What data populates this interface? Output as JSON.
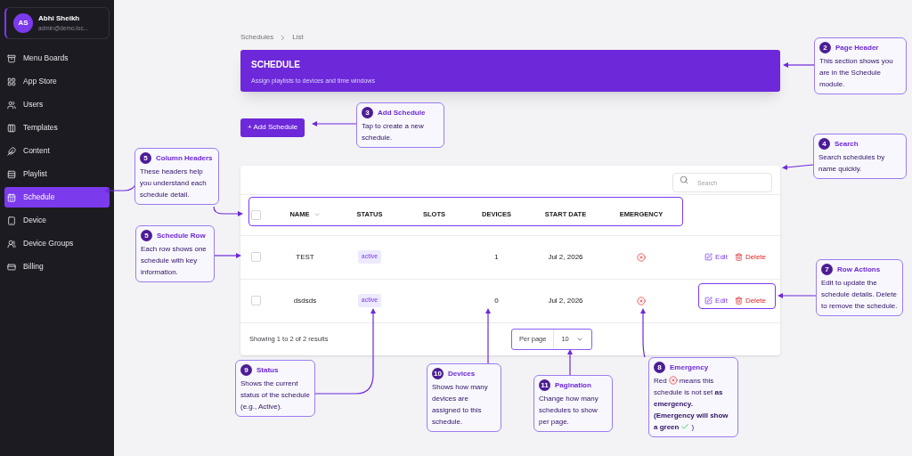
{
  "profile": {
    "initials": "AS",
    "name": "Abhi Sheikh",
    "email": "admin@demo.loc..."
  },
  "sidebar": {
    "items": [
      {
        "label": "Menu Boards",
        "kind": "box",
        "selected": false
      },
      {
        "label": "App Store",
        "kind": "apps",
        "selected": false
      },
      {
        "label": "Users",
        "kind": "users",
        "selected": false
      },
      {
        "label": "Templates",
        "kind": "columns",
        "selected": false
      },
      {
        "label": "Content",
        "kind": "feather",
        "selected": false
      },
      {
        "label": "Playlist",
        "kind": "rows",
        "selected": false
      },
      {
        "label": "Schedule",
        "kind": "calendar",
        "selected": true
      },
      {
        "label": "Device",
        "kind": "tablet",
        "selected": false
      },
      {
        "label": "Device Groups",
        "kind": "group",
        "selected": false
      },
      {
        "label": "Billing",
        "kind": "card",
        "selected": false
      }
    ]
  },
  "breadcrumb": [
    "Schedules",
    "List"
  ],
  "header": {
    "title": "SCHEDULE",
    "subtitle": "Assign playlists to devices and time windows"
  },
  "add_button": "+ Add Schedule",
  "search": {
    "placeholder": "Search"
  },
  "table": {
    "all_checked": false,
    "columns": [
      "NAME",
      "STATUS",
      "SLOTS",
      "DEVICES",
      "START DATE",
      "EMERGENCY"
    ],
    "rows": [
      {
        "name": "TEST",
        "status": "active",
        "devices": "1",
        "start_date": "Jul 2, 2026",
        "emergency": false,
        "checked": false,
        "edit": "Edit",
        "delete": "Delete"
      },
      {
        "name": "dsdsds",
        "status": "active",
        "devices": "0",
        "start_date": "Jul 2, 2026",
        "emergency": false,
        "checked": false,
        "edit": "Edit",
        "delete": "Delete"
      }
    ]
  },
  "footer": {
    "summary": "Showing 1 to 2 of 2 results",
    "per_page_label": "Per page",
    "per_page": "10"
  },
  "callouts": [
    {
      "number": "2",
      "title": "Page Header",
      "body": [
        "This section shows you are in the Schedule module."
      ]
    },
    {
      "number": "3",
      "title": "Add Schedule",
      "body": [
        "Tap to create a new schedule."
      ]
    },
    {
      "number": "4",
      "title": "Search",
      "body": [
        "Search schedules by name quickly."
      ]
    },
    {
      "number": "5",
      "title": "Column Headers",
      "body": [
        "These headers help you understand each schedule detail."
      ]
    },
    {
      "number": "5",
      "title": "Schedule Row",
      "body": [
        "Each row shows one schedule with key information."
      ]
    },
    {
      "number": "7",
      "title": "Row Actions",
      "body": [
        "Edit to update the schedule details. Delete to remove the schedule."
      ]
    },
    {
      "number": "9",
      "title": "Status",
      "body": [
        "Shows the current status of the schedule (e.g., Active)."
      ]
    },
    {
      "number": "10",
      "title": "Devices",
      "body": [
        "Shows how many devices are assigned to this schedule."
      ]
    },
    {
      "number": "11",
      "title": "Pagination",
      "body": [
        "Change how many schedules to show per page."
      ]
    },
    {
      "number": "8",
      "title": "Emergency",
      "body": [
        "Red",
        "means this schedule is not set **as emergency. (Emergency will show a green**",
        ")"
      ]
    }
  ]
}
